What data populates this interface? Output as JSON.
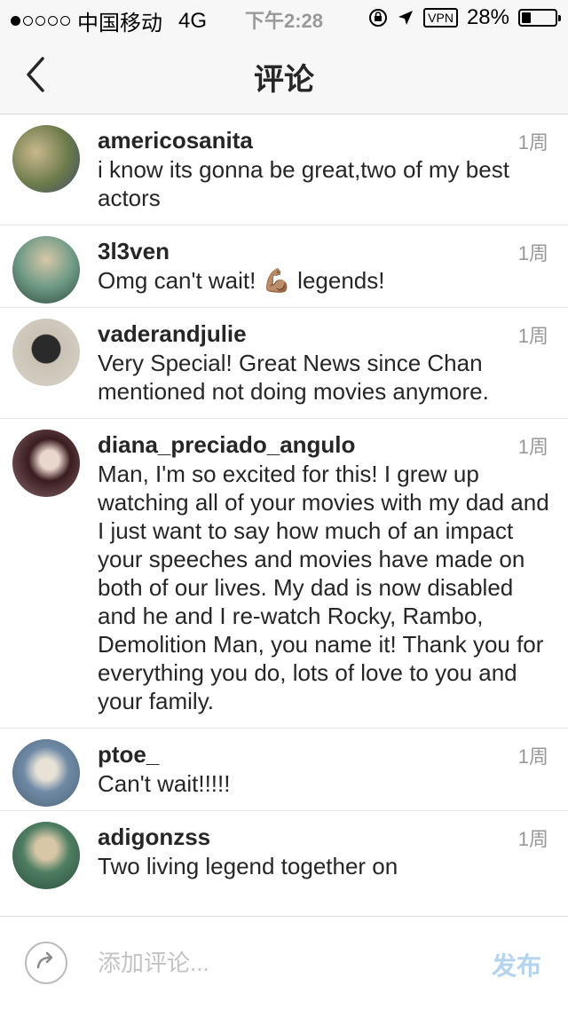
{
  "status": {
    "carrier": "中国移动",
    "network": "4G",
    "time": "下午2:28",
    "vpn": "VPN",
    "battery": "28%",
    "battery_level": 0.28
  },
  "nav": {
    "title": "评论",
    "back_icon": "chevron-left-icon"
  },
  "comments": [
    {
      "user": "americosanita",
      "text": "i know its gonna be great,two of my best actors",
      "time": "1周",
      "avatar_color": "#8a7b55"
    },
    {
      "user": "3l3ven",
      "text": "Omg can't wait! 💪🏽 legends!",
      "time": "1周",
      "avatar_color": "#5f7d64"
    },
    {
      "user": "vaderandjulie",
      "text": "Very Special! Great News since Chan mentioned not  doing movies anymore.",
      "time": "1周",
      "avatar_color": "#3b3b3b"
    },
    {
      "user": "diana_preciado_angulo",
      "text": "Man, I'm so excited for this! I grew up watching all of your movies with my dad and I just want to say how much of an impact your speeches and movies have made on both of our lives. My dad is now disabled and he and I re-watch Rocky, Rambo, Demolition Man, you name it! Thank you for everything you do, lots of love to you and your family.",
      "time": "1周",
      "avatar_color": "#4a2a2f"
    },
    {
      "user": "ptoe_",
      "text": "Can't wait!!!!!",
      "time": "1周",
      "avatar_color": "#7a8fa5"
    },
    {
      "user": "adigonzss",
      "text": "Two living legend together on",
      "time": "1周",
      "avatar_color": "#3f6b4f"
    }
  ],
  "composer": {
    "placeholder": "添加评论...",
    "post_label": "发布",
    "share_icon": "share-icon"
  }
}
